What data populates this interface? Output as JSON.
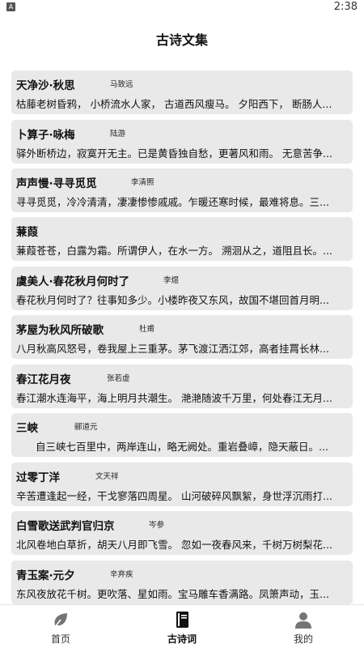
{
  "status_bar": {
    "app_icon": "A",
    "time": "2:38"
  },
  "header": {
    "title": "古诗文集"
  },
  "poems": [
    {
      "title": "天净沙·秋思",
      "author": "马致远",
      "excerpt": "枯藤老树昏鸦， 小桥流水人家， 古道西风瘦马。 夕阳西下， 断肠人..."
    },
    {
      "title": "卜算子·咏梅",
      "author": "陆游",
      "excerpt": "驿外断桥边，寂寞开无主。已是黄昏独自愁，更著风和雨。 无意苦争..."
    },
    {
      "title": "声声慢·寻寻觅觅",
      "author": "李清照",
      "excerpt": "寻寻觅觅，冷冷清清，凄凄惨惨戚戚。乍暖还寒时候，最难将息。三..."
    },
    {
      "title": "蒹葭",
      "author": "",
      "excerpt": "蒹葭苍苍，白露为霜。所谓伊人，在水一方。 溯洄从之，道阻且长。..."
    },
    {
      "title": "虞美人·春花秋月何时了",
      "author": "李煜",
      "excerpt": "春花秋月何时了？往事知多少。小楼昨夜又东风，故国不堪回首月明..."
    },
    {
      "title": "茅屋为秋风所破歌",
      "author": "杜甫",
      "excerpt": "八月秋高风怒号，卷我屋上三重茅。茅飞渡江洒江郊，高者挂罥长林..."
    },
    {
      "title": "春江花月夜",
      "author": "张若虚",
      "excerpt": "春江潮水连海平，海上明月共潮生。 滟滟随波千万里，何处春江无月..."
    },
    {
      "title": "三峡",
      "author": "郦道元",
      "excerpt": "自三峡七百里中，两岸连山，略无阙处。重岩叠嶂，隐天蔽日。..."
    },
    {
      "title": "过零丁洋",
      "author": "文天祥",
      "excerpt": "辛苦遭逢起一经，干戈寥落四周星。 山河破碎风飘絮，身世浮沉雨打..."
    },
    {
      "title": "白雪歌送武判官归京",
      "author": "岑参",
      "excerpt": "北风卷地白草折，胡天八月即飞雪。 忽如一夜春风来，千树万树梨花..."
    },
    {
      "title": "青玉案·元夕",
      "author": "辛弃疾",
      "excerpt": "东风夜放花千树。更吹落、星如雨。宝马雕车香满路。凤箫声动，玉..."
    }
  ],
  "bottom_nav": [
    {
      "label": "首页",
      "icon": "leaf-icon",
      "active": false
    },
    {
      "label": "古诗词",
      "icon": "book-icon",
      "active": true
    },
    {
      "label": "我的",
      "icon": "person-icon",
      "active": false
    }
  ]
}
